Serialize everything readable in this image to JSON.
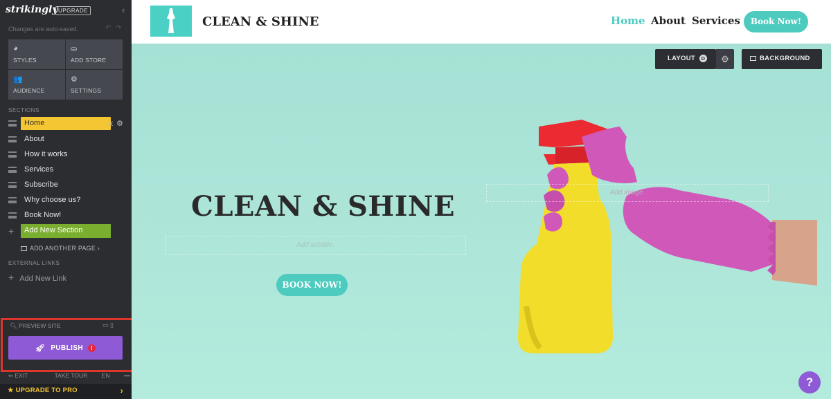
{
  "sidebar": {
    "logo": "strikingly",
    "upgrade_badge": "UPGRADE",
    "collapse_icon": "‹",
    "autosave": "Changes are auto-saved.",
    "tools": [
      {
        "icon": "palette-icon",
        "label": "STYLES"
      },
      {
        "icon": "store-icon",
        "label": "ADD STORE"
      },
      {
        "icon": "audience-icon",
        "label": "AUDIENCE"
      },
      {
        "icon": "gear-icon",
        "label": "SETTINGS"
      }
    ],
    "sections_label": "SECTIONS",
    "sections": [
      {
        "label": "Home",
        "active": true
      },
      {
        "label": "About"
      },
      {
        "label": "How it works"
      },
      {
        "label": "Services"
      },
      {
        "label": "Subscribe"
      },
      {
        "label": "Why choose us?"
      },
      {
        "label": "Book Now!"
      }
    ],
    "add_section": "Add New Section",
    "add_page": "ADD ANOTHER PAGE",
    "external_label": "EXTERNAL LINKS",
    "add_link": "Add New Link",
    "preview": "PREVIEW SITE",
    "publish": "PUBLISH",
    "publish_warning": "!",
    "bottom": {
      "exit": "EXIT",
      "tour": "TAKE TOUR",
      "lang": "EN",
      "more": "•••"
    },
    "upgrade_pro": "UPGRADE TO PRO",
    "colors": {
      "bg": "#2b2d31",
      "active": "#f4c633",
      "add": "#7aae2f",
      "publish": "#8e5ad6",
      "highlight": "#e0352b"
    }
  },
  "site": {
    "name": "CLEAN & SHINE",
    "nav": [
      "Home",
      "About",
      "Services"
    ],
    "nav_button": "Book Now!",
    "layout_btn": "LAYOUT",
    "layout_badge": "D",
    "background_btn": "BACKGROUND",
    "hero_title": "CLEAN & SHINE",
    "subtitle_placeholder": "Add subtitle.",
    "hero_button": "BOOK NOW!",
    "image_placeholder": "Add image.",
    "help": "?",
    "colors": {
      "accent": "#4dcbbf",
      "hero_bg": "#aee6d9"
    }
  }
}
